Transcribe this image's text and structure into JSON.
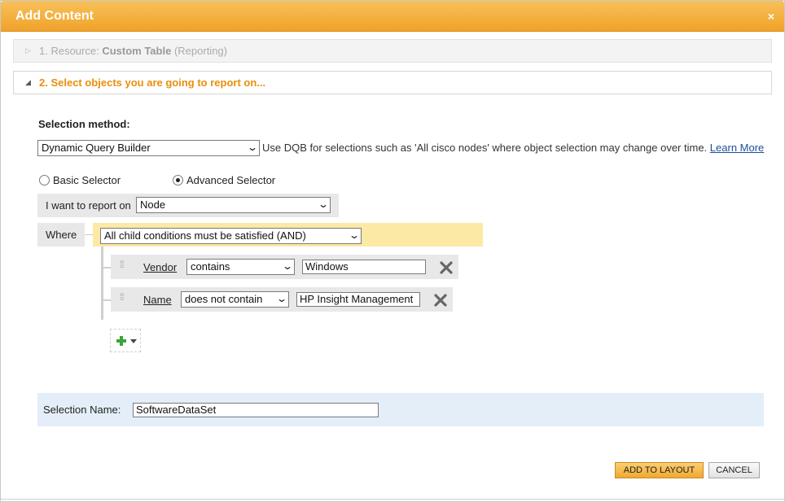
{
  "dialog": {
    "title": "Add Content",
    "close_glyph": "×"
  },
  "steps": [
    {
      "number_prefix": "1. Resource:",
      "name": "Custom Table",
      "suffix": "(Reporting)"
    },
    {
      "label": "2. Select objects you are going to report on..."
    }
  ],
  "selection_method": {
    "label": "Selection method:",
    "value": "Dynamic Query Builder",
    "hint": "Use DQB for selections such as 'All cisco nodes' where object selection may change over time.",
    "learn_more": "Learn More"
  },
  "selector_mode": {
    "basic_label": "Basic Selector",
    "advanced_label": "Advanced Selector",
    "selected": "advanced"
  },
  "report_on": {
    "label": "I want to report on",
    "value": "Node"
  },
  "where": {
    "label": "Where",
    "condition_mode": "All child conditions must be satisfied (AND)"
  },
  "conditions": [
    {
      "field": "Vendor",
      "operator": "contains",
      "value": "Windows"
    },
    {
      "field": "Name",
      "operator": "does not contain",
      "value": "HP Insight Management"
    }
  ],
  "selection_name": {
    "label": "Selection Name:",
    "value": "SoftwareDataSet"
  },
  "buttons": {
    "add_to_layout": "ADD TO LAYOUT",
    "cancel": "CANCEL"
  },
  "colors": {
    "title_bar": "#f0a32a",
    "step_active": "#e8900c",
    "and_bar": "#fde9a6",
    "selection_bar": "#e4eef8"
  },
  "icons": {
    "close": "close-icon",
    "remove": "remove-condition-icon",
    "add": "add-condition-icon",
    "grip": "drag-handle-icon"
  }
}
